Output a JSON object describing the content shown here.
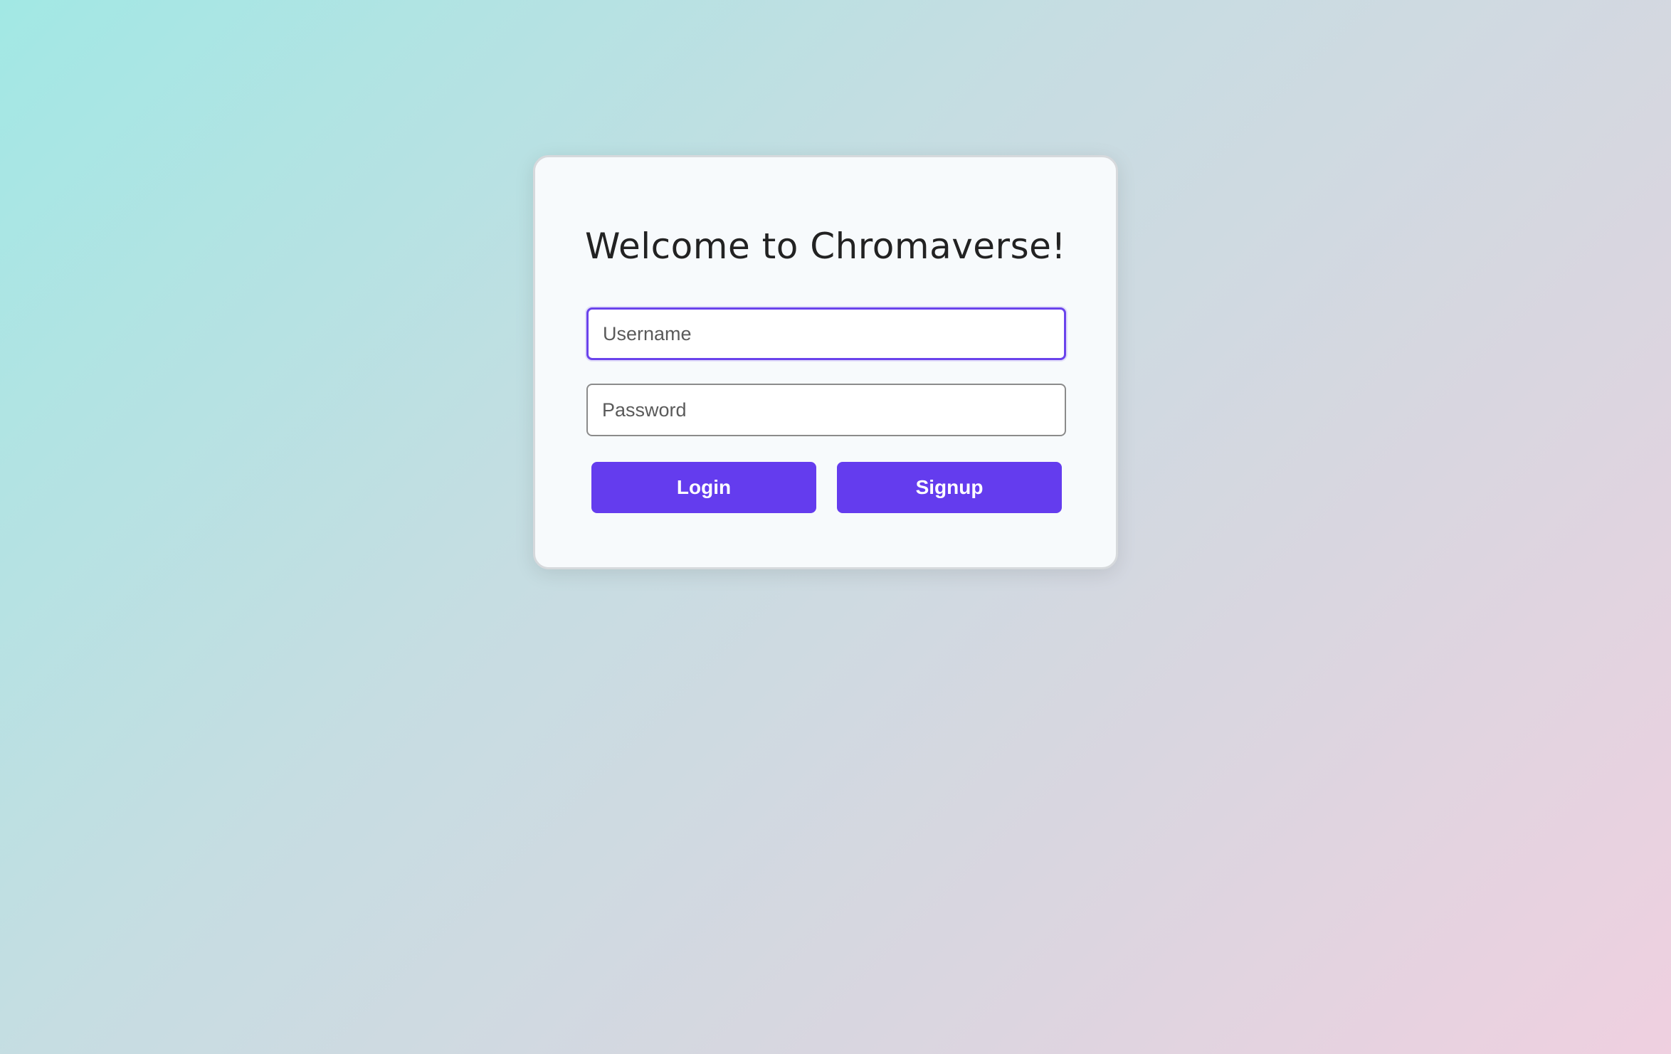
{
  "login_card": {
    "title": "Welcome to Chromaverse!",
    "username": {
      "placeholder": "Username",
      "value": ""
    },
    "password": {
      "placeholder": "Password",
      "value": ""
    },
    "login_label": "Login",
    "signup_label": "Signup"
  },
  "colors": {
    "accent": "#643cee",
    "card_background": "#f7fafc",
    "title_text": "#222222"
  }
}
